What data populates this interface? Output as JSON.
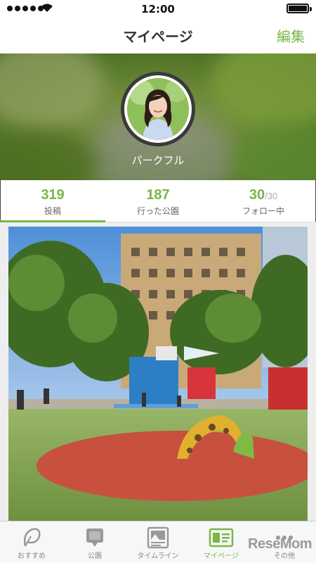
{
  "status_bar": {
    "time": "12:00",
    "signal_dots": 5,
    "battery_level": 1.0
  },
  "nav": {
    "title": "マイページ",
    "edit_label": "編集"
  },
  "profile": {
    "username": "パークフル"
  },
  "stats": [
    {
      "value": "319",
      "suffix": "",
      "label": "投稿",
      "active": true
    },
    {
      "value": "187",
      "suffix": "",
      "label": "行った公園",
      "active": false
    },
    {
      "value": "30",
      "suffix": "/30",
      "label": "フォロー中",
      "active": false
    }
  ],
  "tabs": [
    {
      "label": "おすすめ",
      "icon": "leaf-icon",
      "active": false
    },
    {
      "label": "公園",
      "icon": "speech-bubble-icon",
      "active": false
    },
    {
      "label": "タイムライン",
      "icon": "photo-icon",
      "active": false
    },
    {
      "label": "マイページ",
      "icon": "profile-card-icon",
      "active": true
    },
    {
      "label": "その他",
      "icon": "more-dots-icon",
      "active": false
    }
  ],
  "watermark": {
    "text": "ReseMom"
  },
  "colors": {
    "accent": "#7ab648",
    "text": "#333333",
    "muted": "#888888"
  }
}
